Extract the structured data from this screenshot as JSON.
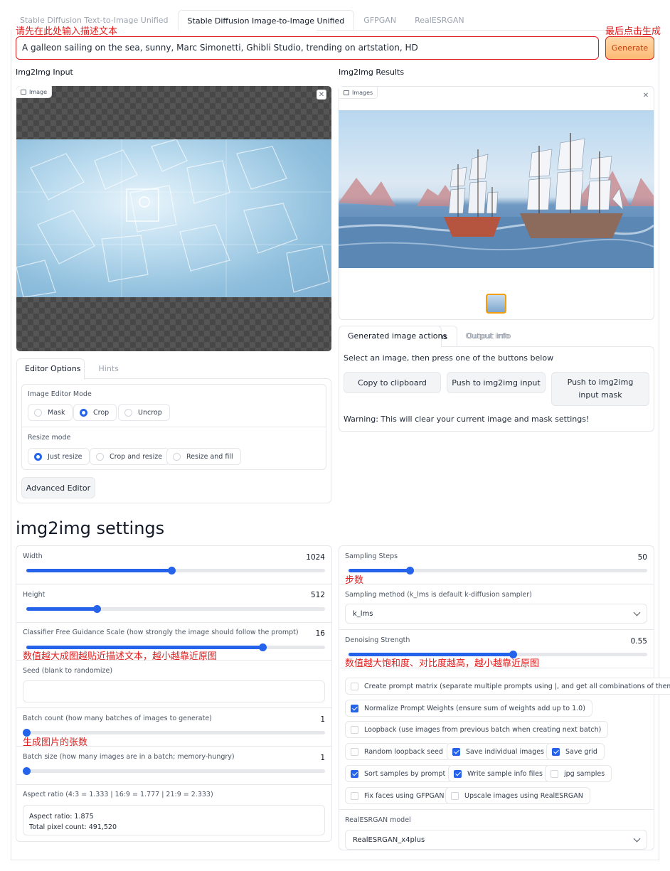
{
  "tabs": [
    {
      "label": "Stable Diffusion Text-to-Image Unified",
      "active": false
    },
    {
      "label": "Stable Diffusion Image-to-Image Unified",
      "active": true
    },
    {
      "label": "GFPGAN",
      "active": false
    },
    {
      "label": "RealESRGAN",
      "active": false
    }
  ],
  "annotations": {
    "prompt": "请先在此处输入描述文本",
    "generate": "最后点击生成",
    "steps": "步数",
    "cfg": "数值越大成图越贴近描述文本，越小越靠近原图",
    "denoise": "数值越大饱和度、对比度越高，越小越靠近原图",
    "batch": "生成图片的张数"
  },
  "prompt": {
    "value": "A galleon sailing on the sea, sunny, Marc Simonetti, Ghibli Studio, trending on artstation, HD"
  },
  "generate_label": "Generate",
  "input_section": {
    "title": "Img2Img Input",
    "image_tag": "Image"
  },
  "results_section": {
    "title": "Img2Img Results",
    "images_tag": "Images"
  },
  "actions": {
    "tabs": [
      {
        "label": "Generated image actions",
        "active": true
      },
      {
        "label": "Output info",
        "active": false
      }
    ],
    "instruction": "Select an image, then press one of the buttons below",
    "buttons": [
      "Copy to clipboard",
      "Push to img2img input",
      "Push to img2img input mask"
    ],
    "warning": "Warning: This will clear your current image and mask settings!"
  },
  "editor": {
    "tabs": [
      {
        "label": "Editor Options",
        "active": true
      },
      {
        "label": "Hints",
        "active": false
      }
    ],
    "mode_label": "Image Editor Mode",
    "modes": [
      {
        "label": "Mask",
        "selected": false
      },
      {
        "label": "Crop",
        "selected": true
      },
      {
        "label": "Uncrop",
        "selected": false
      }
    ],
    "resize_label": "Resize mode",
    "resize_modes": [
      {
        "label": "Just resize",
        "selected": true
      },
      {
        "label": "Crop and resize",
        "selected": false
      },
      {
        "label": "Resize and fill",
        "selected": false
      }
    ],
    "advanced_button": "Advanced Editor"
  },
  "settings": {
    "title": "img2img settings",
    "width": {
      "label": "Width",
      "value": "1024",
      "fraction": 0.485
    },
    "height": {
      "label": "Height",
      "value": "512",
      "fraction": 0.235
    },
    "cfg": {
      "label": "Classifier Free Guidance Scale (how strongly the image should follow the prompt)",
      "value": "16",
      "fraction": 0.79
    },
    "seed": {
      "label": "Seed (blank to randomize)",
      "value": ""
    },
    "batch_count": {
      "label": "Batch count (how many batches of images to generate)",
      "value": "1",
      "fraction": 0.0
    },
    "batch_size": {
      "label": "Batch size (how many images are in a batch; memory-hungry)",
      "value": "1",
      "fraction": 0.0
    },
    "aspect_label": "Aspect ratio (4:3 = 1.333 | 16:9 = 1.777 | 21:9 = 2.333)",
    "aspect_line1": "Aspect ratio: 1.875",
    "aspect_line2": "Total pixel count: 491,520",
    "steps": {
      "label": "Sampling Steps",
      "value": "50",
      "fraction": 0.205
    },
    "sampler": {
      "label": "Sampling method (k_lms is default k-diffusion sampler)",
      "value": "k_lms"
    },
    "denoise": {
      "label": "Denoising Strength",
      "value": "0.55",
      "fraction": 0.55
    },
    "checkboxes": [
      {
        "label": "Create prompt matrix (separate multiple prompts using |, and get all combinations of them)",
        "checked": false
      },
      {
        "label": "Normalize Prompt Weights (ensure sum of weights add up to 1.0)",
        "checked": true
      },
      {
        "label": "Loopback (use images from previous batch when creating next batch)",
        "checked": false
      },
      {
        "label": "Random loopback seed",
        "checked": false
      },
      {
        "label": "Save individual images",
        "checked": true
      },
      {
        "label": "Save grid",
        "checked": true
      },
      {
        "label": "Sort samples by prompt",
        "checked": true
      },
      {
        "label": "Write sample info files",
        "checked": true
      },
      {
        "label": "jpg samples",
        "checked": false
      },
      {
        "label": "Fix faces using GFPGAN",
        "checked": false
      },
      {
        "label": "Upscale images using RealESRGAN",
        "checked": false
      }
    ],
    "esrgan": {
      "label": "RealESRGAN model",
      "value": "RealESRGAN_x4plus"
    }
  }
}
